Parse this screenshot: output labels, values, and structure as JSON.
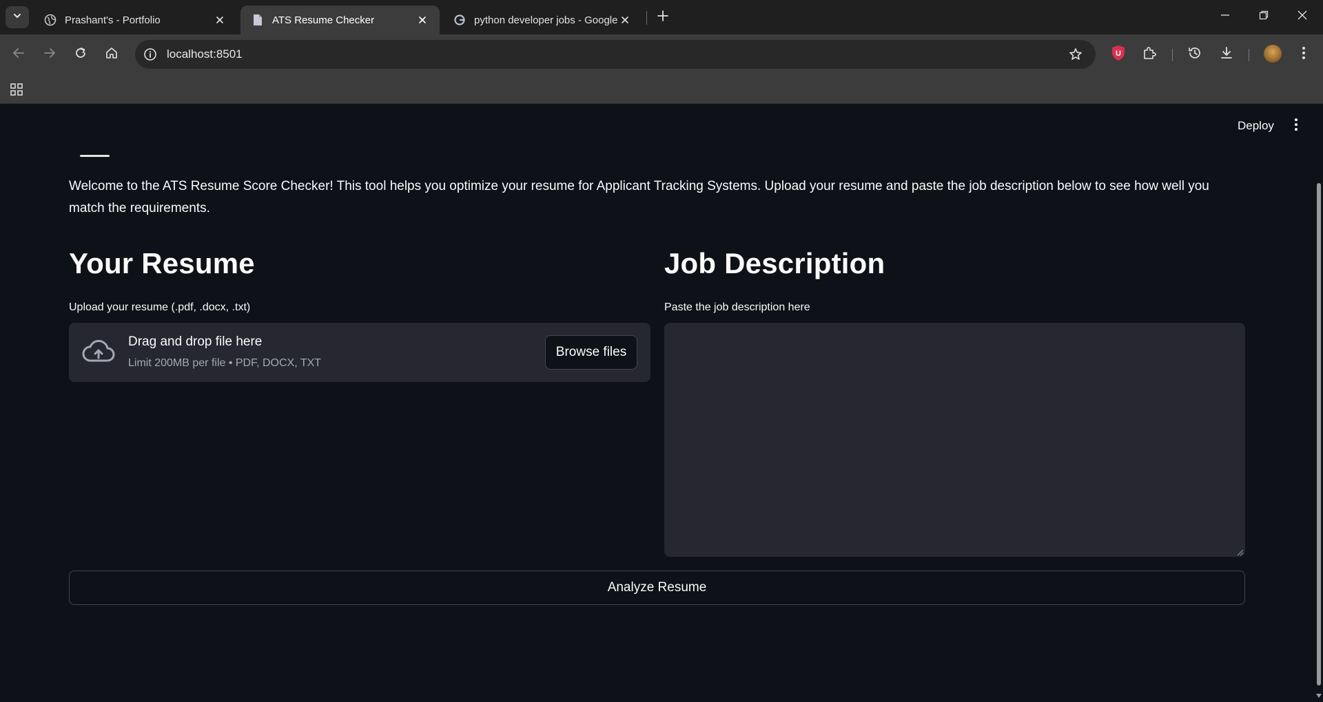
{
  "browser": {
    "tabs": [
      {
        "title": "Prashant's - Portfolio",
        "active": false,
        "favicon": "globe-icon"
      },
      {
        "title": "ATS Resume Checker",
        "active": true,
        "favicon": "document-icon"
      },
      {
        "title": "python developer jobs - Google",
        "active": false,
        "favicon": "google-icon"
      }
    ],
    "url": "localhost:8501",
    "colors": {
      "tabstrip": "#1f1f1f",
      "toolbar": "#3c3c3c",
      "omnibox": "#282828"
    }
  },
  "app": {
    "deploy_label": "Deploy",
    "welcome_text": "Welcome to the ATS Resume Score Checker! This tool helps you optimize your resume for Applicant Tracking Systems. Upload your resume and paste the job description below to see how well you match the requirements.",
    "resume": {
      "heading": "Your Resume",
      "upload_label": "Upload your resume (.pdf, .docx, .txt)",
      "drop_title": "Drag and drop file here",
      "drop_limit": "Limit 200MB per file • PDF, DOCX, TXT",
      "browse_label": "Browse files"
    },
    "job": {
      "heading": "Job Description",
      "input_label": "Paste the job description here",
      "value": ""
    },
    "analyze_label": "Analyze Resume",
    "colors": {
      "background": "#0e1117",
      "surface": "#262730",
      "text": "#fafafa",
      "muted_text": "#a3a8b8"
    }
  }
}
